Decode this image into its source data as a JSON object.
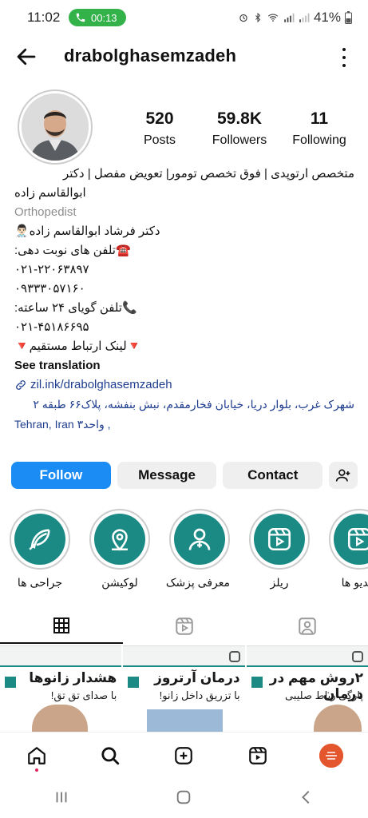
{
  "status_bar": {
    "time": "11:02",
    "call_timer": "00:13",
    "battery": "41%"
  },
  "header": {
    "username": "drabolghasemzadeh"
  },
  "profile": {
    "stats": [
      {
        "value": "520",
        "label": "Posts"
      },
      {
        "value": "59.8K",
        "label": "Followers"
      },
      {
        "value": "11",
        "label": "Following"
      }
    ],
    "bio_name_line1": "متخصص ارتوپدی | فوق تخصص تومور| تعویض مفصل | دکتر",
    "bio_name_line2": "ابوالقاسم زاده",
    "category": "Orthopedist",
    "bio_lines": [
      "دکتر فرشاد ابوالقاسم زاده👨🏻‍⚕️",
      "☎️تلفن های نوبت دهی:",
      "۰۲۱-۲۲۰۶۳۸۹۷",
      "۰۹۳۳۳۰۵۷۱۶۰",
      "📞تلفن گویای ۲۴ ساعته:",
      "۰۲۱-۴۵۱۸۶۶۹۵",
      "🔻لینک ارتباط مستقیم🔻"
    ],
    "see_translation": "See translation",
    "link": "zil.ink/drabolghasemzadeh",
    "address_line1": "شهرک غرب، بلوار دریا، خیابان فخارمقدم، نبش بنفشه، پلاک۶۶ طبقه ۲",
    "address_line2": "Tehran, Iran واحد۳ ,"
  },
  "actions": {
    "follow": "Follow",
    "message": "Message",
    "contact": "Contact"
  },
  "highlights": [
    {
      "label": "جراحی ها",
      "icon": "feather-icon"
    },
    {
      "label": "لوکیشن",
      "icon": "location-pin-icon"
    },
    {
      "label": "معرفی پزشک",
      "icon": "doctor-icon"
    },
    {
      "label": "ریلز",
      "icon": "reels-icon"
    },
    {
      "label": "ویدیو ها",
      "icon": "reels-icon"
    }
  ],
  "posts": [
    {
      "title": "هشدار زانوها",
      "subtitle": "با صدای تق تق!"
    },
    {
      "title": "درمان آرتروز",
      "subtitle": "با تزریق داخل زانو!"
    },
    {
      "title": "۲روش مهم در درمان",
      "subtitle": "پارگی رباط صلیبی"
    }
  ],
  "colors": {
    "follow_button": "#1c8cf5",
    "highlight_teal": "#1b8a84",
    "link_blue": "#1e3d8f",
    "call_pill": "#33b24a"
  }
}
